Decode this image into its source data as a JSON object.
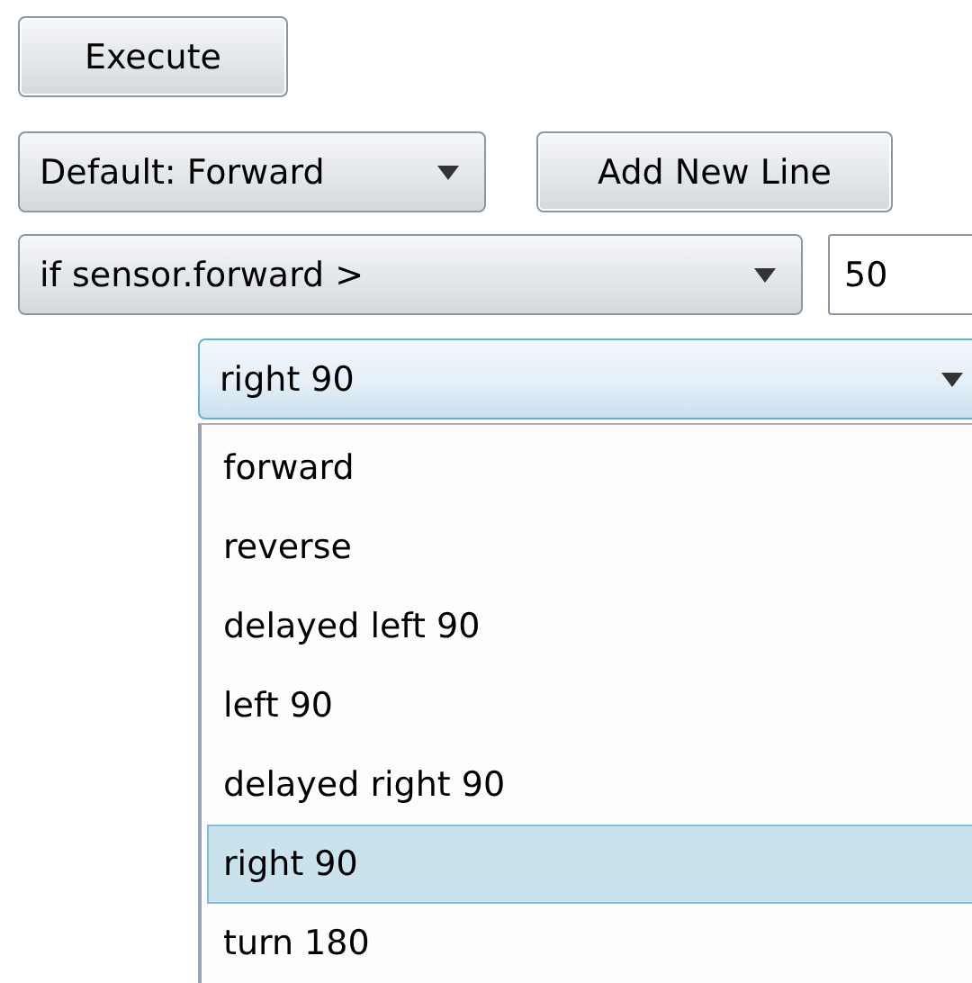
{
  "execute_button": {
    "label": "Execute"
  },
  "default_select": {
    "value": "Default: Forward"
  },
  "add_line_button": {
    "label": "Add New Line"
  },
  "condition_select": {
    "value": "if sensor.forward >"
  },
  "threshold_input": {
    "value": "50"
  },
  "action_select": {
    "value": "right 90",
    "expanded": true,
    "options": [
      {
        "label": "forward",
        "selected": false
      },
      {
        "label": "reverse",
        "selected": false
      },
      {
        "label": "delayed left 90",
        "selected": false
      },
      {
        "label": "left 90",
        "selected": false
      },
      {
        "label": "delayed right 90",
        "selected": false
      },
      {
        "label": "right 90",
        "selected": true
      },
      {
        "label": "turn 180",
        "selected": false
      }
    ]
  }
}
